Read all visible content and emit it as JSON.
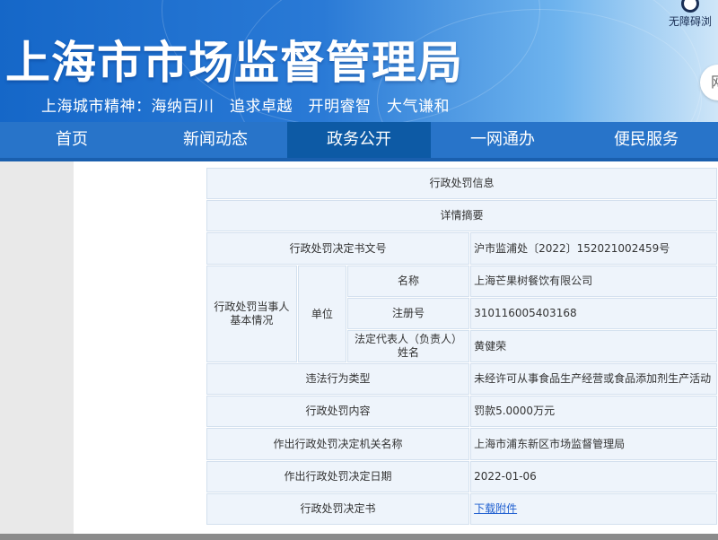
{
  "header": {
    "site_title": "上海市市场监督管理局",
    "slogan": "上海城市精神：海纳百川　追求卓越　开明睿智　大气谦和",
    "accessibility_label": "无障碍浏",
    "search_glyph": "网"
  },
  "nav": {
    "items": [
      {
        "label": "首页"
      },
      {
        "label": "新闻动态"
      },
      {
        "label": "政务公开",
        "active": true
      },
      {
        "label": "一网通办"
      },
      {
        "label": "便民服务"
      }
    ]
  },
  "penalty": {
    "title": "行政处罚信息",
    "subtitle": "详情摘要",
    "doc_no_label": "行政处罚决定书文号",
    "doc_no_value": "沪市监浦处〔2022〕152021002459号",
    "party_label": "行政处罚当事人基本情况",
    "unit_label": "单位",
    "name_label": "名称",
    "name_value": "上海芒果树餐饮有限公司",
    "reg_no_label": "注册号",
    "reg_no_value": "310116005403168",
    "legal_rep_label": "法定代表人（负责人）姓名",
    "legal_rep_value": "黄健荣",
    "violation_type_label": "违法行为类型",
    "violation_type_value": "未经许可从事食品生产经营或食品添加剂生产活动",
    "content_label": "行政处罚内容",
    "content_value": "罚款5.0000万元",
    "authority_label": "作出行政处罚决定机关名称",
    "authority_value": "上海市浦东新区市场监督管理局",
    "date_label": "作出行政处罚决定日期",
    "date_value": "2022-01-06",
    "decision_label": "行政处罚决定书",
    "decision_link": "下载附件"
  },
  "colors": {
    "nav_bg": "#2874c9",
    "nav_active": "#0d5aa5",
    "cell_bg": "#eef4fb",
    "link": "#1f5fd0"
  }
}
